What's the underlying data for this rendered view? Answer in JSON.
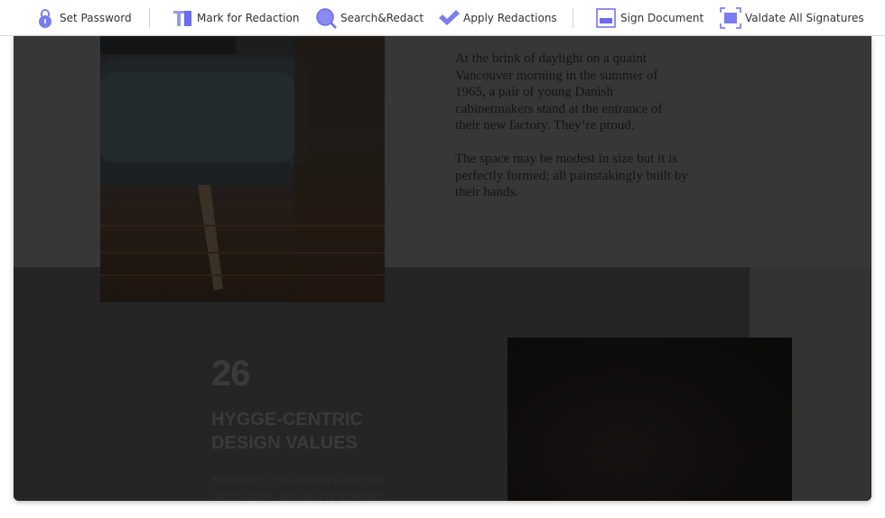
{
  "toolbar": {
    "set_password": "Set Password",
    "mark_for_redaction": "Mark for Redaction",
    "search_redact": "Search&Redact",
    "apply_redactions": "Apply Redactions",
    "sign_document": "Sign Document",
    "validate_signatures": "Valdate All Signatures",
    "accent_color": "#6b6bf0"
  },
  "document": {
    "paragraph_1": "At the brink of daylight on a quaint Vancouver morning in the summer of 1965, a pair of young Danish cabinetmakers stand at the entrance of their new factory. They’re proud.",
    "paragraph_2": "The space may be modest in size but it is perfectly formed; all painstakingly built by their hands.",
    "stat_number": "26",
    "heading_line_1": "HYGGE-CENTRIC",
    "heading_line_2": "DESIGN VALUES",
    "caption": "Simplicity, craftsmanship, elegant functionality and quality materials"
  }
}
